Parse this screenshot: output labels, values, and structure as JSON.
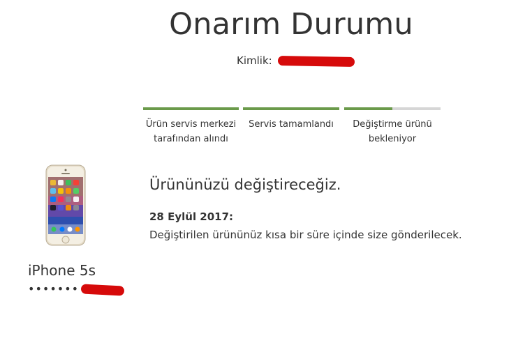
{
  "page": {
    "title": "Onarım Durumu",
    "case_id_label": "Kimlik:"
  },
  "progress": {
    "steps": [
      {
        "label": "Ürün servis merkezi tarafından alındı",
        "fill": 1.0
      },
      {
        "label": "Servis tamamlandı",
        "fill": 1.0
      },
      {
        "label": "Değiştirme ürünü bekleniyor",
        "fill": 0.5
      }
    ],
    "colors": {
      "complete": "#6a9a4a",
      "pending": "#d6d6d6"
    }
  },
  "device": {
    "name": "iPhone 5s",
    "serial_masked": "•••••••",
    "image_icon": "iphone-icon"
  },
  "status": {
    "heading": "Ürününüzü değiştireceğiz.",
    "date": "28 Eylül 2017:",
    "message": "Değiştirilen ürününüz kısa bir süre içinde size gönderilecek."
  },
  "redaction_color": "#d60a0a"
}
